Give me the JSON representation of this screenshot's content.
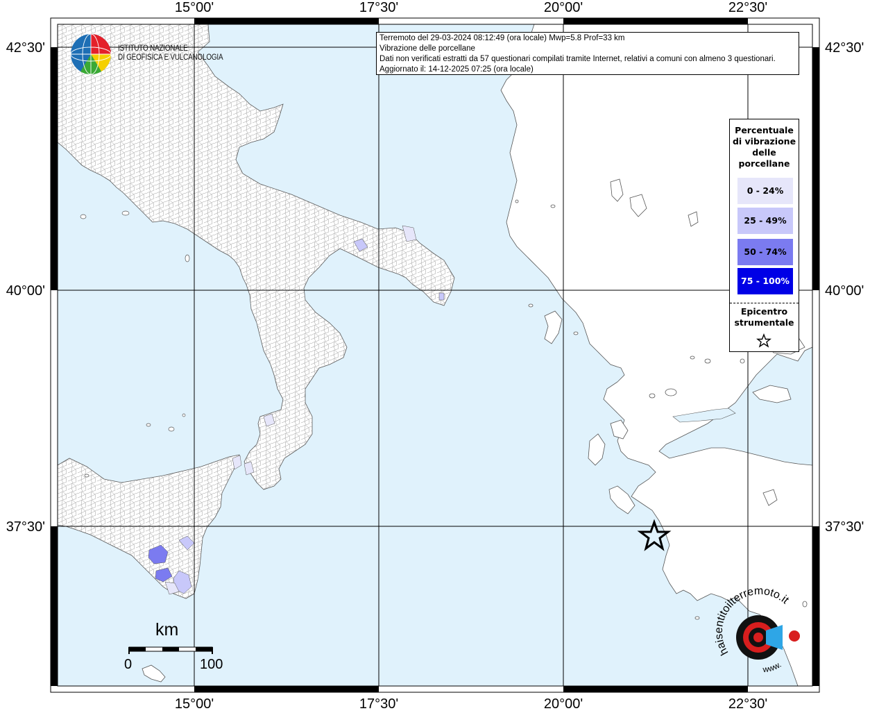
{
  "map": {
    "type": "macroseismic-map",
    "info": {
      "line1": "Terremoto del 29-03-2024 08:12:49 (ora locale) Mwp=5.8 Prof=33 km",
      "line2": "Vibrazione delle porcellane",
      "line3": "Dati non verificati estratti da 57 questionari compilati tramite Internet, relativi a comuni con almeno 3 questionari.",
      "line4": "Aggiornato il: 14-12-2025 07:25 (ora locale)"
    },
    "longitude_ticks": [
      "15°00'",
      "17°30'",
      "20°00'",
      "22°30'"
    ],
    "latitude_ticks": [
      "42°30'",
      "40°00'",
      "37°30'"
    ],
    "legend": {
      "title_lines": [
        "Percentuale",
        "di vibrazione",
        "delle",
        "porcellane"
      ],
      "classes": [
        {
          "label": "0 - 24%",
          "color": "#e6e6fa",
          "text_color": "#000000"
        },
        {
          "label": "25 - 49%",
          "color": "#c8c8fa",
          "text_color": "#000000"
        },
        {
          "label": "50 - 74%",
          "color": "#7b7bf0",
          "text_color": "#000000"
        },
        {
          "label": "75 - 100%",
          "color": "#0000e6",
          "text_color": "#ffffff"
        }
      ],
      "epicenter_lines": [
        "Epicentro",
        "strumentale"
      ]
    },
    "scale": {
      "unit": "km",
      "start": "0",
      "end": "100"
    },
    "ingv_logo": {
      "lines": [
        "ISTITUTO NAZIONALE",
        "DI GEOFISICA E VULCANOLOGIA"
      ]
    },
    "hsit_logo": {
      "text": "haisentitoilterremoto.it",
      "subtext": "www."
    },
    "colors": {
      "sea": "#e0f2fc",
      "land": "#ffffff",
      "border": "#8a8a8a",
      "grid": "#000000",
      "frame": "#000000"
    }
  }
}
